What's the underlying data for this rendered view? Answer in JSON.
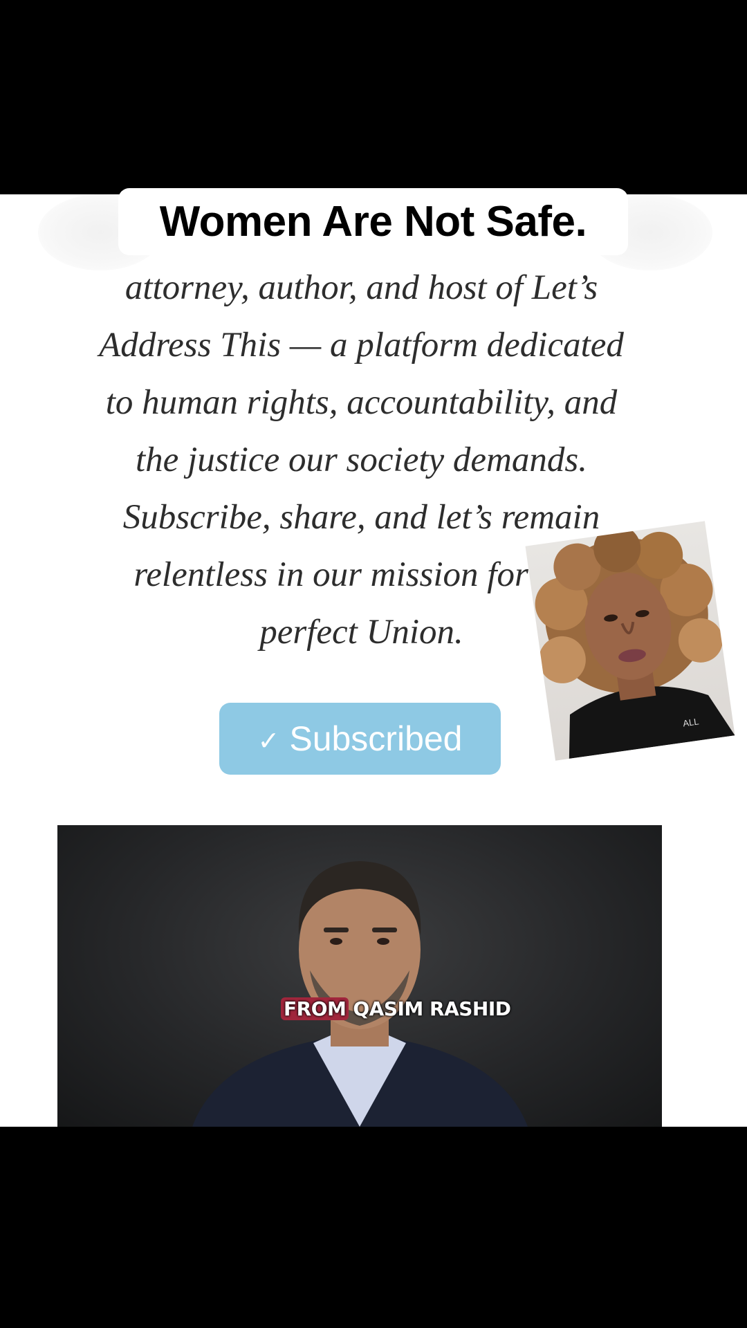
{
  "caption": "Women Are Not Safe.",
  "article": {
    "lines": [
      "attorney, author, and host of Let’s",
      "Address This — a platform dedicated",
      "to human rights, accountability, and",
      "the justice our society demands.",
      "Subscribe, share, and let’s remain",
      "relentless in our mission for a m",
      "perfect Union."
    ]
  },
  "subscribe_button": {
    "label": "Subscribed",
    "icon": "checkmark-icon",
    "color": "#8ec9e4"
  },
  "photo": {
    "caption_prefix": "FROM",
    "caption_name": "QASIM RASHID",
    "highlight_color": "#a0263c"
  },
  "pip_overlay": {
    "shirt_text": "ALL"
  }
}
